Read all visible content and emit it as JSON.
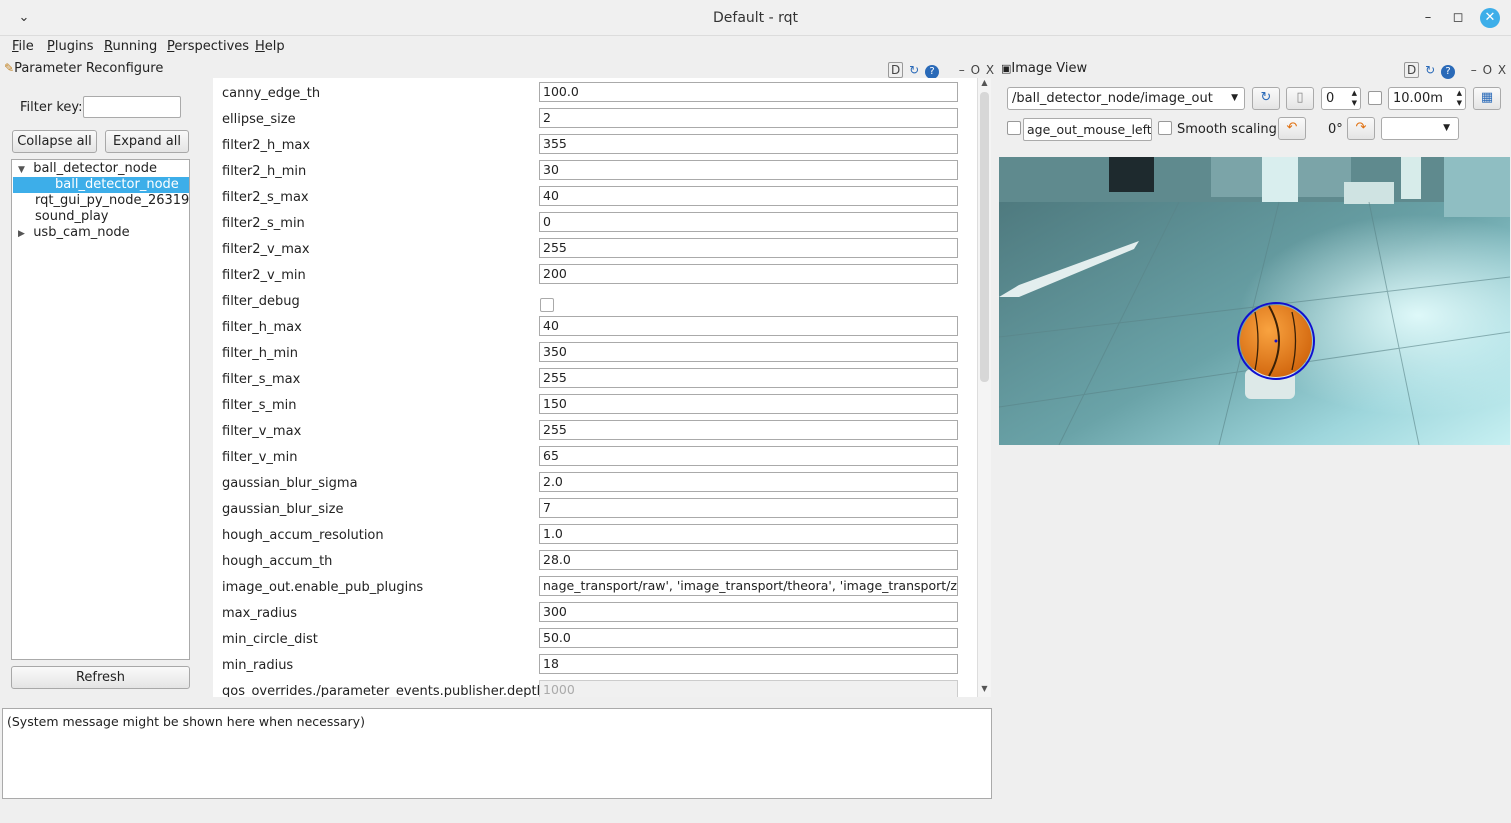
{
  "window": {
    "title": "Default - rqt"
  },
  "menu": [
    "File",
    "Plugins",
    "Running",
    "Perspectives",
    "Help"
  ],
  "param_dock": {
    "title": "Parameter Reconfigure",
    "buttons": [
      "D",
      "O",
      "X"
    ]
  },
  "filter": {
    "label": "Filter key:",
    "value": ""
  },
  "buttons": {
    "collapse": "Collapse all",
    "expand": "Expand all",
    "refresh": "Refresh"
  },
  "tree": [
    {
      "label": "ball_detector_node",
      "expanded": true
    },
    {
      "label": "ball_detector_node",
      "selected": true
    },
    {
      "label": "rqt_gui_py_node_26319"
    },
    {
      "label": "sound_play"
    },
    {
      "label": "usb_cam_node",
      "collapsed": true
    }
  ],
  "params": [
    {
      "name": "canny_edge_th",
      "value": "100.0"
    },
    {
      "name": "ellipse_size",
      "value": "2"
    },
    {
      "name": "filter2_h_max",
      "value": "355"
    },
    {
      "name": "filter2_h_min",
      "value": "30"
    },
    {
      "name": "filter2_s_max",
      "value": "40"
    },
    {
      "name": "filter2_s_min",
      "value": "0"
    },
    {
      "name": "filter2_v_max",
      "value": "255"
    },
    {
      "name": "filter2_v_min",
      "value": "200"
    },
    {
      "name": "filter_debug",
      "value": ""
    },
    {
      "name": "filter_h_max",
      "value": "40"
    },
    {
      "name": "filter_h_min",
      "value": "350"
    },
    {
      "name": "filter_s_max",
      "value": "255"
    },
    {
      "name": "filter_s_min",
      "value": "150"
    },
    {
      "name": "filter_v_max",
      "value": "255"
    },
    {
      "name": "filter_v_min",
      "value": "65"
    },
    {
      "name": "gaussian_blur_sigma",
      "value": "2.0"
    },
    {
      "name": "gaussian_blur_size",
      "value": "7"
    },
    {
      "name": "hough_accum_resolution",
      "value": "1.0"
    },
    {
      "name": "hough_accum_th",
      "value": "28.0"
    },
    {
      "name": "image_out.enable_pub_plugins",
      "value": "nage_transport/raw', 'image_transport/theora', 'image_transport/zstd']"
    },
    {
      "name": "max_radius",
      "value": "300"
    },
    {
      "name": "min_circle_dist",
      "value": "50.0"
    },
    {
      "name": "min_radius",
      "value": "18"
    },
    {
      "name": "qos_overrides./parameter_events.publisher.depth",
      "value": "1000"
    }
  ],
  "system_message": "(System message might be shown here when necessary)",
  "image_dock": {
    "title": "Image View",
    "buttons": [
      "D",
      "O",
      "X"
    ],
    "topic": "/ball_detector_node/image_out",
    "num_value": "0",
    "max_value": "10.00m",
    "mouse_topic": "age_out_mouse_left",
    "smooth_label": "Smooth scaling",
    "rotation": "0°"
  },
  "colors": {
    "selection": "#3daee9",
    "ball": "#e8801a",
    "circle": "#1010d0"
  }
}
